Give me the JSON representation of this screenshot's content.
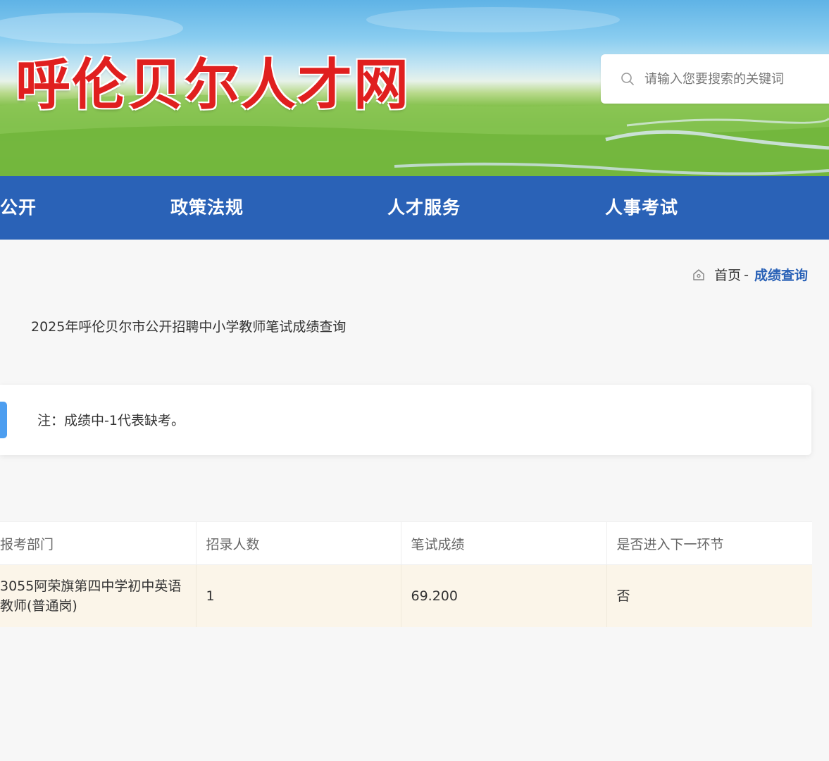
{
  "header": {
    "site_title": "呼伦贝尔人才网",
    "search": {
      "placeholder": "请输入您要搜索的关键词",
      "value": ""
    }
  },
  "nav": {
    "items": [
      {
        "label": "公开"
      },
      {
        "label": "政策法规"
      },
      {
        "label": "人才服务"
      },
      {
        "label": "人事考试"
      }
    ]
  },
  "breadcrumb": {
    "home": "首页",
    "separator": "-",
    "current": "成绩查询"
  },
  "page_title": "2025年呼伦贝尔市公开招聘中小学教师笔试成绩查询",
  "notice": {
    "text": "注：成绩中-1代表缺考。"
  },
  "table": {
    "headers": [
      "报考部门",
      "招录人数",
      "笔试成绩",
      "是否进入下一环节"
    ],
    "rows": [
      [
        "3055阿荣旗第四中学初中英语教师(普通岗)",
        "1",
        "69.200",
        "否"
      ]
    ]
  },
  "colors": {
    "nav_bg": "#2a62b7",
    "title_red": "#e01f1f",
    "link_blue": "#2a62b7",
    "notice_accent": "#4d9ef0",
    "row_highlight": "#fbf5e9"
  },
  "icons": {
    "search": "search-icon",
    "home": "home-icon"
  }
}
